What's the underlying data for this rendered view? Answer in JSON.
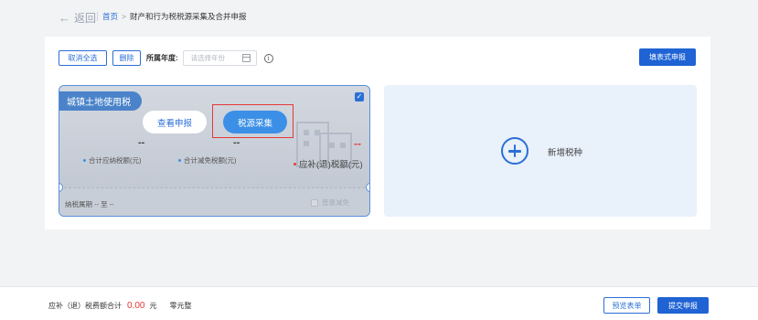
{
  "header": {
    "back_label": "返回",
    "breadcrumb_home": "首页",
    "breadcrumb_separator": ">",
    "breadcrumb_current": "财产和行为税税源采集及合并申报"
  },
  "toolbar": {
    "cancel_select_label": "取消全选",
    "delete_label": "删除",
    "year_label": "所属年度:",
    "year_placeholder": "请选择年份",
    "fill_report_label": "填表式申报"
  },
  "tax_card": {
    "title": "城镇土地使用税",
    "checked": true,
    "view_button": "查看申报",
    "collect_button": "税源采集",
    "total_payable_value": "--",
    "total_payable_label": "合计应纳税额(元)",
    "total_reduction_value": "--",
    "total_reduction_label": "合计减免税额(元)",
    "refund_value": "--",
    "refund_label": "应补(退)税额(元)",
    "period_label": "纳税属期 -- 至 --",
    "benefit_label": "普惠减免"
  },
  "add_card": {
    "label": "新增税种"
  },
  "footer": {
    "total_label": "应补（退）税费额合计",
    "total_amount": "0.00",
    "unit": "元",
    "amount_words": "零元整",
    "preview_label": "预览表单",
    "submit_label": "提交申报"
  },
  "colors": {
    "primary": "#1f63d4",
    "accent_red": "#e53935",
    "card_title_bg": "#4a83c9",
    "add_card_bg": "#e9f1fb"
  }
}
